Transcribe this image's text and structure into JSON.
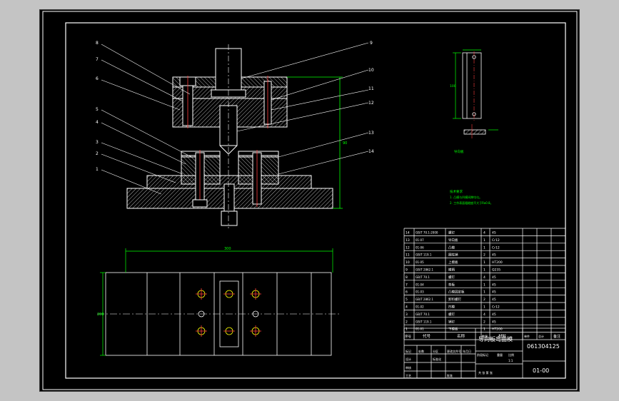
{
  "drawing": {
    "callouts": [
      "1",
      "2",
      "3",
      "4",
      "5",
      "6",
      "7",
      "8",
      "9",
      "10",
      "11",
      "12",
      "13",
      "14"
    ],
    "dimension_total_width": "300",
    "dimension_height_side": "90",
    "dimension_plan_width": "200",
    "detail_dimension": "100",
    "detail_caption": "导向板",
    "tech_req_title": "技术要求",
    "tech_req_1": "1. 凸模与凹模间隙均匀。",
    "tech_req_2": "2. 工作表面粗糙度不大于Ra0.8。"
  },
  "bom": {
    "rows": [
      {
        "no": "14",
        "code": "GB/T 70.1-2000",
        "name": "螺钉",
        "qty": "4",
        "material": "45"
      },
      {
        "no": "13",
        "code": "01-07",
        "name": "导向板",
        "qty": "1",
        "material": "Cr12"
      },
      {
        "no": "12",
        "code": "01-06",
        "name": "凸模",
        "qty": "1",
        "material": "Cr12"
      },
      {
        "no": "11",
        "code": "GB/T 119.1",
        "name": "圆柱销",
        "qty": "2",
        "material": "45"
      },
      {
        "no": "10",
        "code": "01-05",
        "name": "上模板",
        "qty": "1",
        "material": "HT200"
      },
      {
        "no": "9",
        "code": "GB/T 2862.1",
        "name": "模柄",
        "qty": "1",
        "material": "Q235"
      },
      {
        "no": "8",
        "code": "GB/T 70.1",
        "name": "螺钉",
        "qty": "4",
        "material": "45"
      },
      {
        "no": "7",
        "code": "01-04",
        "name": "垫板",
        "qty": "1",
        "material": "45"
      },
      {
        "no": "6",
        "code": "01-03",
        "name": "凸模固定板",
        "qty": "1",
        "material": "45"
      },
      {
        "no": "5",
        "code": "GB/T 2862.1",
        "name": "卸料螺钉",
        "qty": "2",
        "material": "45"
      },
      {
        "no": "4",
        "code": "01-02",
        "name": "凹模",
        "qty": "1",
        "material": "Cr12"
      },
      {
        "no": "3",
        "code": "GB/T 70.1",
        "name": "螺钉",
        "qty": "4",
        "material": "45"
      },
      {
        "no": "2",
        "code": "GB/T 119.1",
        "name": "销钉",
        "qty": "2",
        "material": "45"
      },
      {
        "no": "1",
        "code": "01-01",
        "name": "下模板",
        "qty": "1",
        "material": "HT200"
      }
    ],
    "header": {
      "no": "序号",
      "code": "代号",
      "name": "名称",
      "qty": "数量",
      "material": "材料",
      "unit_weight": "单件",
      "total_weight": "总计",
      "remark": "备注"
    }
  },
  "title_block": {
    "title": "导向板弯曲模",
    "code": "061304125",
    "drawing_no": "01-00",
    "mark": "标记",
    "count": "处数",
    "zone": "分区",
    "change_doc": "更改文件号",
    "sign": "签名",
    "date": "年月日",
    "design": "设计",
    "standardize": "标准化",
    "stage_mark": "阶段标记",
    "weight": "重量",
    "scale": "比例",
    "scale_value": "1:1",
    "review": "审核",
    "process": "工艺",
    "approve": "批准",
    "sheets": "共 张 第 张"
  },
  "colors": {
    "background": "#000000",
    "line": "#ffffff",
    "hatch": "#ffffff",
    "dimension": "#00ff00",
    "center": "#ffffff",
    "hole_cross": "#ff3b3b",
    "hole_circle": "#ffff00",
    "frame_outer": "#ffffff",
    "app_bg": "#c4c4c4"
  }
}
